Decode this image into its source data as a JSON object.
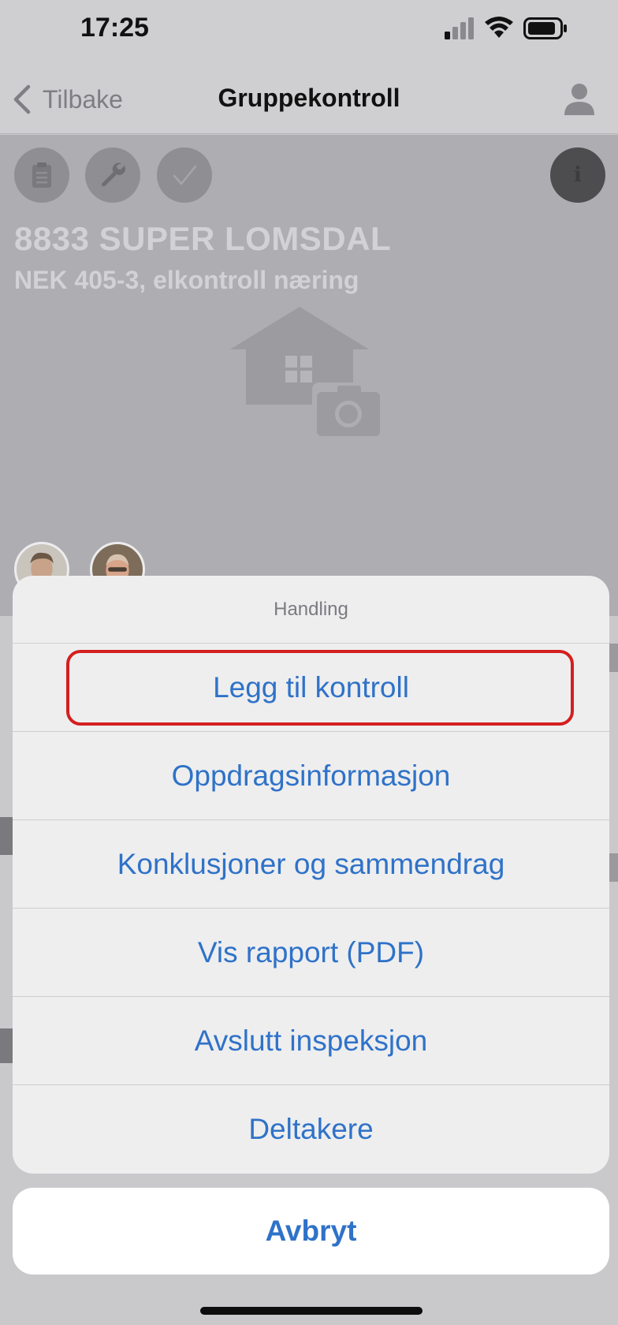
{
  "status_bar": {
    "time": "17:25"
  },
  "nav": {
    "back_label": "Tilbake",
    "title": "Gruppekontroll"
  },
  "header": {
    "site_name": "8833 SUPER LOMSDAL",
    "subtitle": "NEK 405-3, elkontroll næring",
    "info_glyph": "i",
    "buttons": [
      "clipboard-icon",
      "wrench-icon",
      "checkmark-icon"
    ]
  },
  "action_sheet": {
    "title": "Handling",
    "items": [
      "Legg til kontroll",
      "Oppdragsinformasjon",
      "Konklusjoner og sammendrag",
      "Vis rapport (PDF)",
      "Avslutt inspeksjon",
      "Deltakere"
    ],
    "highlighted_item": "Legg til kontroll",
    "cancel_label": "Avbryt"
  },
  "colors": {
    "accent": "#2f72c8",
    "highlight_border": "#d41f1f",
    "dim_background": "#adadb2"
  }
}
